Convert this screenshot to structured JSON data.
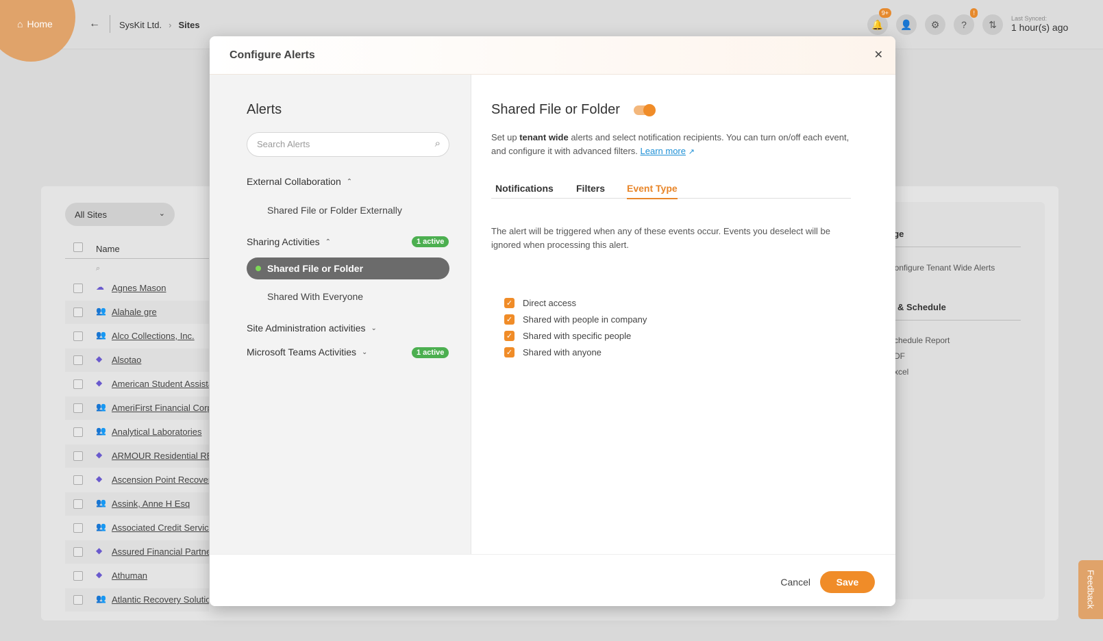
{
  "topbar": {
    "home_label": "Home",
    "crumb_org": "SysKit Ltd.",
    "crumb_page": "Sites",
    "notif_badge": "9+",
    "help_badge": "!",
    "last_synced_label": "Last Synced:",
    "last_synced_value": "1 hour(s) ago"
  },
  "background": {
    "filter_label": "All Sites",
    "name_col": "Name",
    "sites": [
      "Agnes Mason",
      "Alahale gre",
      "Alco Collections, Inc.",
      "Alsotao",
      "American Student Assista",
      "AmeriFirst Financial Corp",
      "Analytical Laboratories",
      "ARMOUR Residential REI",
      "Ascension Point Recovery",
      "Assink, Anne H Esq",
      "Associated Credit Service",
      "Assured Financial Partner",
      "Athuman",
      "Atlantic Recovery Solution"
    ],
    "right_panel": {
      "manage_title": "age",
      "configure_item": "Configure Tenant Wide Alerts",
      "report_title": "rt & Schedule",
      "schedule_item": "Schedule Report",
      "pdf_item": "PDF",
      "excel_item": "Excel"
    },
    "feedback_label": "Feedback"
  },
  "modal": {
    "title": "Configure Alerts",
    "close_glyph": "✕",
    "left": {
      "heading": "Alerts",
      "search_placeholder": "Search Alerts",
      "groups": [
        {
          "label": "External Collaboration",
          "badge": ""
        },
        {
          "label": "Sharing Activities",
          "badge": "1 active"
        },
        {
          "label": "Site Administration activities",
          "badge": ""
        },
        {
          "label": "Microsoft Teams Activities",
          "badge": "1 active"
        }
      ],
      "items": {
        "external_shared": "Shared File or Folder Externally",
        "shared_file": "Shared File or Folder",
        "shared_everyone": "Shared With Everyone"
      }
    },
    "right": {
      "title": "Shared File or Folder",
      "desc_pre": "Set up ",
      "desc_bold": "tenant wide",
      "desc_post": " alerts and select notification recipients. You can turn on/off each event, and configure it with advanced filters. ",
      "learn_more": "Learn more",
      "tabs": [
        "Notifications",
        "Filters",
        "Event Type"
      ],
      "active_tab": "Event Type",
      "trigger_text": "The alert will be triggered when any of these events occur. Events you deselect will be ignored when processing this alert.",
      "events": [
        "Direct access",
        "Shared with people in company",
        "Shared with specific people",
        "Shared with anyone"
      ]
    },
    "footer": {
      "cancel": "Cancel",
      "save": "Save"
    }
  },
  "colors": {
    "accent": "#f08c28",
    "badge_green": "#4caf50",
    "link": "#1e90d6"
  }
}
